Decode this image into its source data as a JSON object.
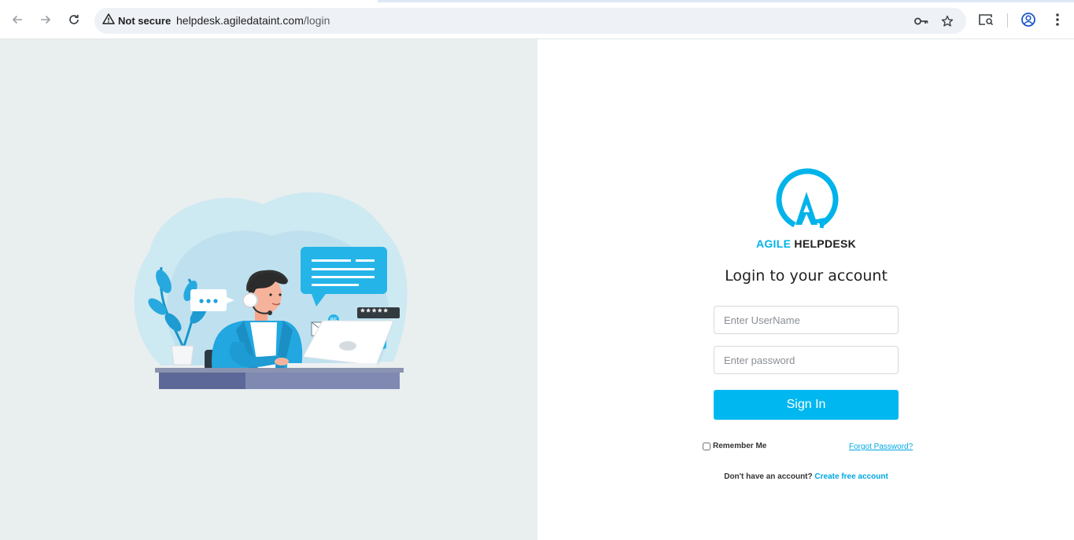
{
  "browser": {
    "security_label": "Not secure",
    "url_host": "helpdesk.agiledataint.com",
    "url_path": "/login",
    "icons": [
      "back-arrow-icon",
      "forward-arrow-icon",
      "reload-icon",
      "warning-icon",
      "key-icon",
      "star-icon",
      "media-search-icon",
      "profile-icon",
      "more-vert-icon"
    ]
  },
  "brand": {
    "accent_word": "AGILE",
    "rest": " HELPDESK",
    "accent_color": "#00b3ea"
  },
  "login": {
    "title": "Login to your account",
    "username_placeholder": "Enter UserName",
    "password_placeholder": "Enter password",
    "signin_label": "Sign In",
    "remember_label": "Remember Me",
    "forgot_label": "Forgot Password?",
    "signup_prompt": "Don't have an account?",
    "signup_link": "Create free account"
  },
  "illustration": {
    "mail_badge": "85",
    "password_stars": "*****"
  },
  "colors": {
    "primary": "#00b8ef",
    "left_bg": "#e9eeee"
  }
}
